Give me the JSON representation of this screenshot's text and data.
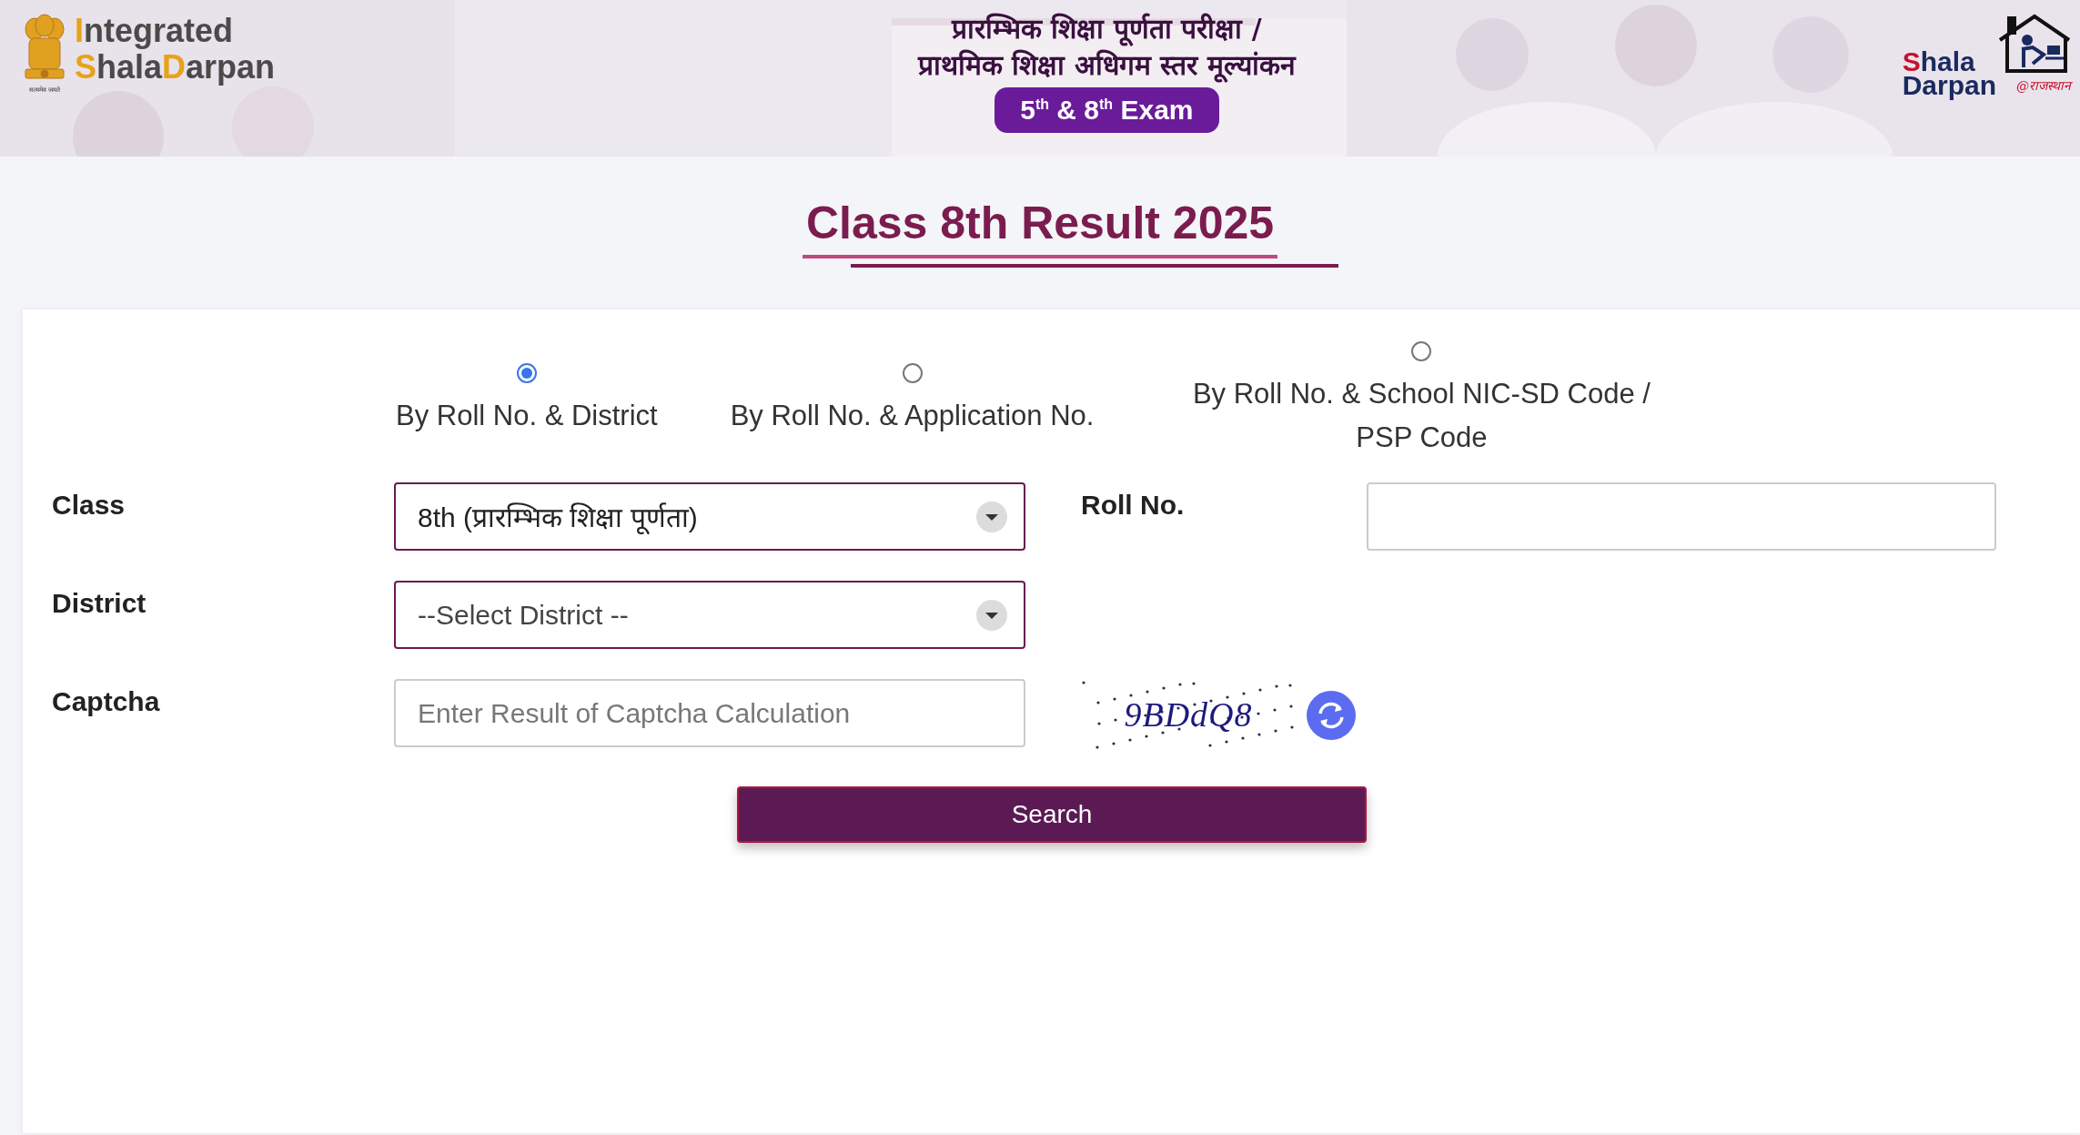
{
  "header": {
    "logo_left": {
      "line1": [
        {
          "text": "I",
          "accent": true
        },
        {
          "text": "ntegrated",
          "accent": false
        }
      ],
      "line2": [
        {
          "text": "S",
          "accent": true
        },
        {
          "text": "hala",
          "accent": false
        },
        {
          "text": "D",
          "accent": true
        },
        {
          "text": "arpan",
          "accent": false
        }
      ],
      "motto": "सत्यमेव जयते"
    },
    "heading_lines": [
      "प्रारम्भिक शिक्षा पूर्णता परीक्षा /",
      "प्राथमिक शिक्षा अधिगम स्तर मूल्यांकन"
    ],
    "exam_badge": "5$^{th}$ & 8$^{th}$ Exam",
    "logo_right": {
      "line1": [
        {
          "text": "S",
          "accent": true
        },
        {
          "text": "hala",
          "accent": false
        }
      ],
      "line2": "Darpan",
      "tagline": "@राजस्थान"
    }
  },
  "page_title": "Class 8th Result 2025",
  "search_modes": [
    {
      "label": "By Roll No. & District",
      "selected": true
    },
    {
      "label": "By Roll No. & Application No.",
      "selected": false
    },
    {
      "label": "By Roll No. & School NIC-SD Code / PSP Code",
      "selected": false
    }
  ],
  "form": {
    "class": {
      "label": "Class",
      "value": "8th (प्रारम्भिक शिक्षा पूर्णता)"
    },
    "roll_no": {
      "label": "Roll No."
    },
    "district": {
      "label": "District",
      "value": "--Select District --"
    },
    "captcha": {
      "label": "Captcha",
      "placeholder": "Enter Result of Captcha Calculation",
      "image_text": "9BDdQ8"
    }
  },
  "search_button": "Search"
}
